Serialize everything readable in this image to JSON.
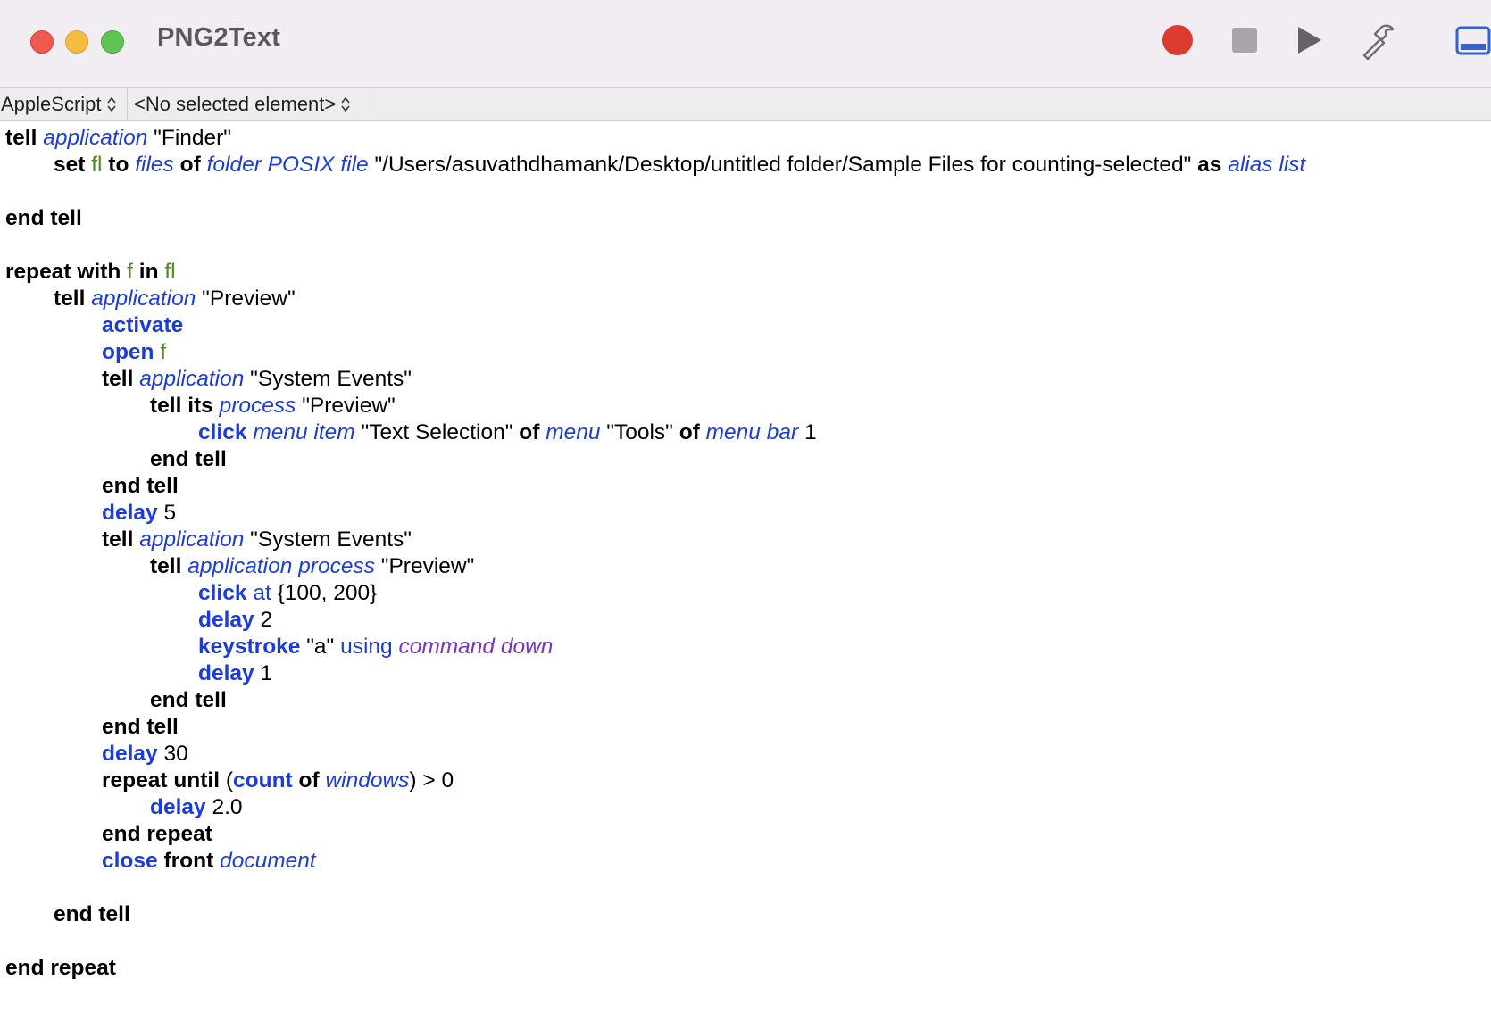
{
  "window": {
    "title": "PNG2Text",
    "accent_colors": {
      "record": "#dd3a30",
      "close": "#ee5a52",
      "minimize": "#f5bd3f",
      "zoom": "#5fc454",
      "keyword_blue": "#1b3cdb",
      "variable_green": "#4a8a1e",
      "enum_purple": "#7a33c8"
    }
  },
  "toolbar": {
    "record_icon": "record-icon",
    "stop_icon": "stop-icon",
    "run_icon": "run-icon",
    "compile_icon": "hammer-icon",
    "panel_icon": "show-panel-icon"
  },
  "navbar": {
    "language": "AppleScript",
    "element": "<No selected element>"
  },
  "script": {
    "lines": [
      {
        "indent": 0,
        "tokens": [
          [
            "kw",
            "tell"
          ],
          [
            "t",
            " "
          ],
          [
            "cls",
            "application"
          ],
          [
            "t",
            " \"Finder\""
          ]
        ]
      },
      {
        "indent": 1,
        "tokens": [
          [
            "kw",
            "set"
          ],
          [
            "t",
            " "
          ],
          [
            "var",
            "fl"
          ],
          [
            "t",
            " "
          ],
          [
            "kw",
            "to"
          ],
          [
            "t",
            " "
          ],
          [
            "cls",
            "files"
          ],
          [
            "t",
            " "
          ],
          [
            "kw",
            "of"
          ],
          [
            "t",
            " "
          ],
          [
            "cls",
            "folder POSIX file"
          ],
          [
            "t",
            " \"/Users/asuvathdhamank/Desktop/untitled folder/Sample Files for counting-selected\" "
          ],
          [
            "kw",
            "as"
          ],
          [
            "t",
            " "
          ],
          [
            "cls",
            "alias list"
          ]
        ]
      },
      {
        "indent": 0,
        "tokens": []
      },
      {
        "indent": 0,
        "tokens": [
          [
            "kw",
            "end tell"
          ]
        ]
      },
      {
        "indent": 0,
        "tokens": []
      },
      {
        "indent": 0,
        "tokens": [
          [
            "kw",
            "repeat with"
          ],
          [
            "t",
            " "
          ],
          [
            "var",
            "f"
          ],
          [
            "t",
            " "
          ],
          [
            "kw",
            "in"
          ],
          [
            "t",
            " "
          ],
          [
            "var",
            "fl"
          ]
        ]
      },
      {
        "indent": 1,
        "tokens": [
          [
            "kw",
            "tell"
          ],
          [
            "t",
            " "
          ],
          [
            "cls",
            "application"
          ],
          [
            "t",
            " \"Preview\""
          ]
        ]
      },
      {
        "indent": 2,
        "tokens": [
          [
            "cmd",
            "activate"
          ]
        ]
      },
      {
        "indent": 2,
        "tokens": [
          [
            "cmd",
            "open"
          ],
          [
            "t",
            " "
          ],
          [
            "var",
            "f"
          ]
        ]
      },
      {
        "indent": 2,
        "tokens": [
          [
            "kw",
            "tell"
          ],
          [
            "t",
            " "
          ],
          [
            "cls",
            "application"
          ],
          [
            "t",
            " \"System Events\""
          ]
        ]
      },
      {
        "indent": 3,
        "tokens": [
          [
            "kw",
            "tell its"
          ],
          [
            "t",
            " "
          ],
          [
            "cls",
            "process"
          ],
          [
            "t",
            " \"Preview\""
          ]
        ]
      },
      {
        "indent": 4,
        "tokens": [
          [
            "cmd",
            "click"
          ],
          [
            "t",
            " "
          ],
          [
            "cls",
            "menu item"
          ],
          [
            "t",
            " \"Text Selection\" "
          ],
          [
            "kw",
            "of"
          ],
          [
            "t",
            " "
          ],
          [
            "cls",
            "menu"
          ],
          [
            "t",
            " \"Tools\" "
          ],
          [
            "kw",
            "of"
          ],
          [
            "t",
            " "
          ],
          [
            "cls",
            "menu bar"
          ],
          [
            "t",
            " 1"
          ]
        ]
      },
      {
        "indent": 3,
        "tokens": [
          [
            "kw",
            "end tell"
          ]
        ]
      },
      {
        "indent": 2,
        "tokens": [
          [
            "kw",
            "end tell"
          ]
        ]
      },
      {
        "indent": 2,
        "tokens": [
          [
            "cmd",
            "delay"
          ],
          [
            "t",
            " 5"
          ]
        ]
      },
      {
        "indent": 2,
        "tokens": [
          [
            "kw",
            "tell"
          ],
          [
            "t",
            " "
          ],
          [
            "cls",
            "application"
          ],
          [
            "t",
            " \"System Events\""
          ]
        ]
      },
      {
        "indent": 3,
        "tokens": [
          [
            "kw",
            "tell"
          ],
          [
            "t",
            " "
          ],
          [
            "cls",
            "application process"
          ],
          [
            "t",
            " \"Preview\""
          ]
        ]
      },
      {
        "indent": 4,
        "tokens": [
          [
            "cmd",
            "click"
          ],
          [
            "t",
            " "
          ],
          [
            "prm",
            "at"
          ],
          [
            "t",
            " {100, 200}"
          ]
        ]
      },
      {
        "indent": 4,
        "tokens": [
          [
            "cmd",
            "delay"
          ],
          [
            "t",
            " 2"
          ]
        ]
      },
      {
        "indent": 4,
        "tokens": [
          [
            "cmd",
            "keystroke"
          ],
          [
            "t",
            " \"a\" "
          ],
          [
            "prm",
            "using"
          ],
          [
            "t",
            " "
          ],
          [
            "enm",
            "command down"
          ]
        ]
      },
      {
        "indent": 4,
        "tokens": [
          [
            "cmd",
            "delay"
          ],
          [
            "t",
            " 1"
          ]
        ]
      },
      {
        "indent": 3,
        "tokens": [
          [
            "kw",
            "end tell"
          ]
        ]
      },
      {
        "indent": 2,
        "tokens": [
          [
            "kw",
            "end tell"
          ]
        ]
      },
      {
        "indent": 2,
        "tokens": [
          [
            "cmd",
            "delay"
          ],
          [
            "t",
            " 30"
          ]
        ]
      },
      {
        "indent": 2,
        "tokens": [
          [
            "kw",
            "repeat until"
          ],
          [
            "t",
            " ("
          ],
          [
            "cmd",
            "count"
          ],
          [
            "t",
            " "
          ],
          [
            "kw",
            "of"
          ],
          [
            "t",
            " "
          ],
          [
            "cls",
            "windows"
          ],
          [
            "t",
            ") > 0"
          ]
        ]
      },
      {
        "indent": 3,
        "tokens": [
          [
            "cmd",
            "delay"
          ],
          [
            "t",
            " 2.0"
          ]
        ]
      },
      {
        "indent": 2,
        "tokens": [
          [
            "kw",
            "end repeat"
          ]
        ]
      },
      {
        "indent": 2,
        "tokens": [
          [
            "cmd",
            "close"
          ],
          [
            "t",
            " "
          ],
          [
            "kw",
            "front"
          ],
          [
            "t",
            " "
          ],
          [
            "cls",
            "document"
          ]
        ]
      },
      {
        "indent": 0,
        "tokens": []
      },
      {
        "indent": 1,
        "tokens": [
          [
            "kw",
            "end tell"
          ]
        ]
      },
      {
        "indent": 0,
        "tokens": []
      },
      {
        "indent": 0,
        "tokens": [
          [
            "kw",
            "end repeat"
          ]
        ]
      }
    ]
  }
}
